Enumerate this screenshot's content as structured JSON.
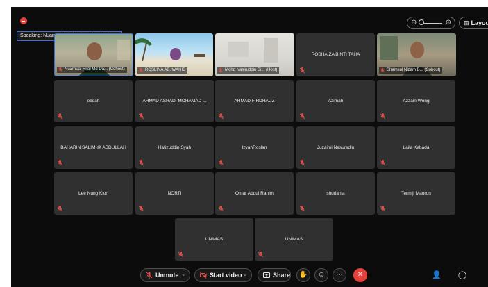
{
  "speaking_label": "Speaking: Nuarnual Hilal Md Dahlan (Cohost)",
  "header": {
    "layout_label": "Layou"
  },
  "video_tiles": [
    {
      "name": "Nuarnual Hilal Md Da... (Cohost)"
    },
    {
      "name": "ROSLINA AB. WAHID"
    },
    {
      "name": "Mohd Nasiruddin Bi... (Host)"
    },
    {
      "name": "ROSHAIZA BINTI TAHA"
    },
    {
      "name": "Shamsul Nizam B... (Cohost)"
    }
  ],
  "participants": [
    "ebdah",
    "AHMAD ASHADI MOHAMAD ...",
    "AHMAD FIRDHAUZ",
    "Azimah",
    "Azzain Wong",
    "BAHARIN SALIM @ ABDULLAH",
    "Hafizuddin Syah",
    "IzyanRoslan",
    "Juzaimi Nasuredin",
    "Laila Kebada",
    "Lee Nung Kion",
    "NORTI",
    "Omar Abdul Rahim",
    "shuriania",
    "Termiji Maoron",
    "UNIMAS",
    "UNIMAS"
  ],
  "toolbar": {
    "unmute_label": "Unmute",
    "video_label": "Start video",
    "share_label": "Share"
  },
  "colors": {
    "background": "#0c0c0c",
    "tile": "#303030",
    "active_border": "#3a6fd8",
    "muted_mic": "#e0504a",
    "leave_button": "#e4413a"
  },
  "icons": [
    "close-dot",
    "zoom-out-icon",
    "zoom-in-icon",
    "layout-grid-icon",
    "mic-muted-icon",
    "video-off-icon",
    "share-icon",
    "reactions-icon",
    "more-icon",
    "leave-call-icon",
    "participants-icon",
    "chat-icon"
  ]
}
